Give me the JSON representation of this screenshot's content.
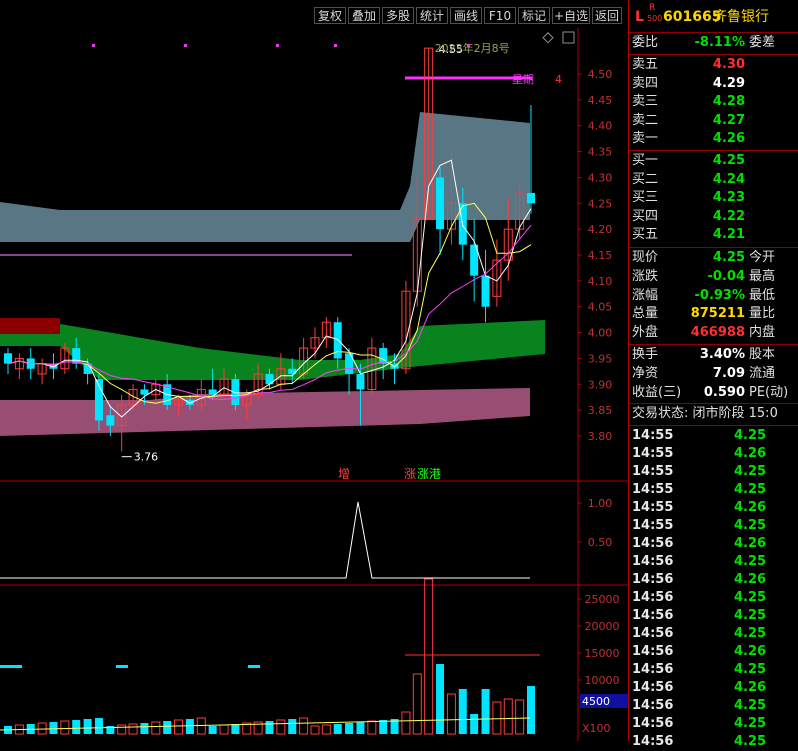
{
  "toolbar": {
    "buttons": [
      "复权",
      "叠加",
      "多股",
      "统计",
      "画线",
      "F10",
      "标记",
      "+自选",
      "返回"
    ]
  },
  "header": {
    "l_badge": "L",
    "r_badge_top": "R",
    "r_badge_bottom": "500",
    "code": "601665",
    "name": "齐鲁银行"
  },
  "orderbook": {
    "weibi_label": "委比",
    "weibi_value": "-8.11%",
    "weicha_label": "委差",
    "sells": [
      {
        "label": "卖五",
        "price": "4.30",
        "color": "red"
      },
      {
        "label": "卖四",
        "price": "4.29",
        "color": "white"
      },
      {
        "label": "卖三",
        "price": "4.28",
        "color": "green"
      },
      {
        "label": "卖二",
        "price": "4.27",
        "color": "green"
      },
      {
        "label": "卖一",
        "price": "4.26",
        "color": "green"
      }
    ],
    "buys": [
      {
        "label": "买一",
        "price": "4.25",
        "color": "green"
      },
      {
        "label": "买二",
        "price": "4.24",
        "color": "green"
      },
      {
        "label": "买三",
        "price": "4.23",
        "color": "green"
      },
      {
        "label": "买四",
        "price": "4.22",
        "color": "green"
      },
      {
        "label": "买五",
        "price": "4.21",
        "color": "green"
      }
    ]
  },
  "quote": {
    "rows": [
      {
        "label": "现价",
        "value": "4.25",
        "color": "green",
        "label2": "今开"
      },
      {
        "label": "涨跌",
        "value": "-0.04",
        "color": "green",
        "label2": "最高"
      },
      {
        "label": "涨幅",
        "value": "-0.93%",
        "color": "green",
        "label2": "最低"
      },
      {
        "label": "总量",
        "value": "875211",
        "color": "yellow",
        "label2": "量比"
      },
      {
        "label": "外盘",
        "value": "466988",
        "color": "red",
        "label2": "内盘"
      }
    ],
    "rows2": [
      {
        "label": "换手",
        "value": "3.40%",
        "color": "white",
        "label2": "股本"
      },
      {
        "label": "净资",
        "value": "7.09",
        "color": "white",
        "label2": "流通"
      },
      {
        "label": "收益(三)",
        "value": "0.590",
        "color": "white",
        "label2": "PE(动)"
      }
    ],
    "trade_status": "交易状态: 闭市阶段 15:0"
  },
  "ticks": [
    {
      "time": "14:55",
      "price": "4.25"
    },
    {
      "time": "14:55",
      "price": "4.26"
    },
    {
      "time": "14:55",
      "price": "4.25"
    },
    {
      "time": "14:55",
      "price": "4.25"
    },
    {
      "time": "14:55",
      "price": "4.26"
    },
    {
      "time": "14:55",
      "price": "4.25"
    },
    {
      "time": "14:56",
      "price": "4.26"
    },
    {
      "time": "14:56",
      "price": "4.25"
    },
    {
      "time": "14:56",
      "price": "4.26"
    },
    {
      "time": "14:56",
      "price": "4.25"
    },
    {
      "time": "14:56",
      "price": "4.25"
    },
    {
      "time": "14:56",
      "price": "4.25"
    },
    {
      "time": "14:56",
      "price": "4.26"
    },
    {
      "time": "14:56",
      "price": "4.25"
    },
    {
      "time": "14:56",
      "price": "4.26"
    },
    {
      "time": "14:56",
      "price": "4.25"
    },
    {
      "time": "14:56",
      "price": "4.25"
    },
    {
      "time": "14:56",
      "price": "4.25"
    }
  ],
  "chart_data": {
    "type": "candlestick",
    "price_axis": [
      "4.50",
      "4.45",
      "4.40",
      "4.35",
      "4.30",
      "4.25",
      "4.20",
      "4.15",
      "4.10",
      "4.05",
      "4.00",
      "3.95",
      "3.90",
      "3.85",
      "3.80"
    ],
    "indicator_axis": [
      "1.00",
      "0.50"
    ],
    "volume_axis": [
      "25000",
      "20000",
      "15000",
      "10000"
    ],
    "volume_box": "4500",
    "volume_unit": "X100",
    "high_annotation": "4.55",
    "low_annotation": "3.76",
    "date_annotation": "2023年2月8号",
    "tag_right": "星期",
    "tag_number": "4",
    "labels_bottom": [
      "增",
      "涨",
      "涨港"
    ],
    "candles": [
      [
        3.96,
        3.94,
        3.97,
        3.92
      ],
      [
        3.93,
        3.95,
        3.96,
        3.91
      ],
      [
        3.95,
        3.93,
        3.97,
        3.91
      ],
      [
        3.92,
        3.94,
        3.95,
        3.9
      ],
      [
        3.94,
        3.93,
        3.96,
        3.91
      ],
      [
        3.93,
        3.97,
        3.98,
        3.92
      ],
      [
        3.97,
        3.94,
        3.99,
        3.93
      ],
      [
        3.94,
        3.92,
        3.95,
        3.9
      ],
      [
        3.91,
        3.83,
        3.92,
        3.81
      ],
      [
        3.84,
        3.82,
        3.86,
        3.8
      ],
      [
        3.82,
        3.86,
        3.88,
        3.77
      ],
      [
        3.86,
        3.89,
        3.9,
        3.85
      ],
      [
        3.89,
        3.88,
        3.9,
        3.86
      ],
      [
        3.88,
        3.9,
        3.91,
        3.87
      ],
      [
        3.9,
        3.86,
        3.92,
        3.85
      ],
      [
        3.86,
        3.87,
        3.88,
        3.84
      ],
      [
        3.87,
        3.86,
        3.88,
        3.85
      ],
      [
        3.86,
        3.89,
        3.91,
        3.85
      ],
      [
        3.89,
        3.88,
        3.93,
        3.87
      ],
      [
        3.88,
        3.91,
        3.93,
        3.87
      ],
      [
        3.91,
        3.86,
        3.92,
        3.85
      ],
      [
        3.86,
        3.88,
        3.89,
        3.83
      ],
      [
        3.88,
        3.92,
        3.94,
        3.87
      ],
      [
        3.92,
        3.9,
        3.93,
        3.89
      ],
      [
        3.9,
        3.93,
        3.96,
        3.89
      ],
      [
        3.93,
        3.92,
        3.95,
        3.9
      ],
      [
        3.92,
        3.97,
        3.99,
        3.91
      ],
      [
        3.97,
        3.99,
        4.01,
        3.95
      ],
      [
        3.99,
        4.02,
        4.03,
        3.97
      ],
      [
        4.02,
        3.95,
        4.03,
        3.93
      ],
      [
        3.96,
        3.92,
        3.97,
        3.88
      ],
      [
        3.92,
        3.89,
        3.94,
        3.82
      ],
      [
        3.89,
        3.97,
        3.99,
        3.88
      ],
      [
        3.97,
        3.94,
        3.98,
        3.91
      ],
      [
        3.94,
        3.93,
        3.96,
        3.9
      ],
      [
        3.93,
        4.08,
        4.1,
        3.92
      ],
      [
        4.08,
        4.22,
        4.3,
        4.05
      ],
      [
        4.22,
        4.55,
        4.55,
        4.22
      ],
      [
        4.3,
        4.2,
        4.32,
        4.15
      ],
      [
        4.2,
        4.25,
        4.35,
        4.17
      ],
      [
        4.25,
        4.17,
        4.28,
        4.14
      ],
      [
        4.17,
        4.11,
        4.22,
        4.06
      ],
      [
        4.11,
        4.05,
        4.16,
        4.02
      ],
      [
        4.07,
        4.14,
        4.18,
        4.05
      ],
      [
        4.14,
        4.2,
        4.26,
        4.1
      ],
      [
        4.2,
        4.27,
        4.29,
        4.18
      ],
      [
        4.27,
        4.25,
        4.44,
        4.23
      ]
    ]
  }
}
